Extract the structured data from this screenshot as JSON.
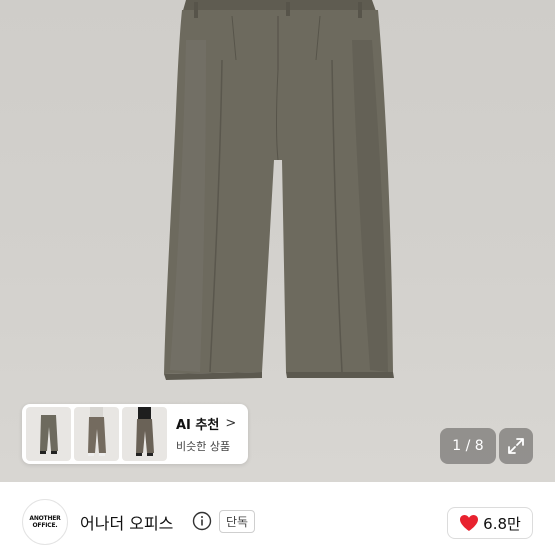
{
  "product": {
    "image_alt": "",
    "thumbnail_count": 3
  },
  "ai_recommend": {
    "title": "AI 추천",
    "chevron": ">",
    "subtitle": "비슷한 상품"
  },
  "gallery": {
    "counter": "1 / 8",
    "expand_icon": "expand-icon"
  },
  "shop": {
    "logo_line1": "ANOTHER",
    "logo_line2": "OFFICE.",
    "name": "어나더 오피스",
    "info_icon": "info-icon",
    "badge": "단독"
  },
  "like": {
    "icon": "heart-icon",
    "count": "6.8만",
    "color": "#e8222f"
  },
  "colors": {
    "pants": "#6d6a5e",
    "background": "#d2d0cc"
  }
}
